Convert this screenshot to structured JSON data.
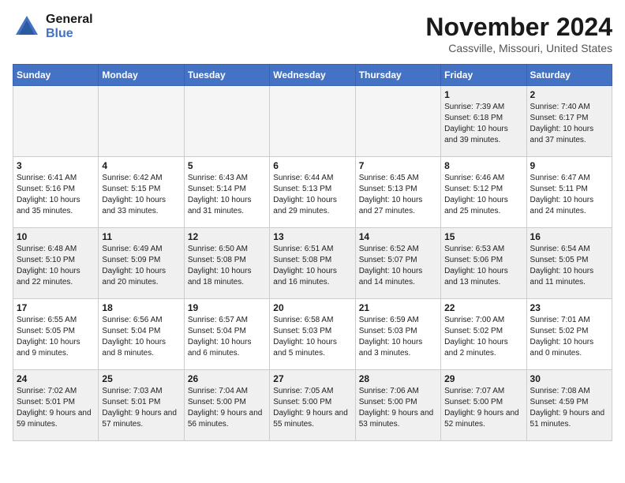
{
  "header": {
    "logo_line1": "General",
    "logo_line2": "Blue",
    "month_title": "November 2024",
    "location": "Cassville, Missouri, United States"
  },
  "weekdays": [
    "Sunday",
    "Monday",
    "Tuesday",
    "Wednesday",
    "Thursday",
    "Friday",
    "Saturday"
  ],
  "weeks": [
    [
      {
        "day": "",
        "empty": true
      },
      {
        "day": "",
        "empty": true
      },
      {
        "day": "",
        "empty": true
      },
      {
        "day": "",
        "empty": true
      },
      {
        "day": "",
        "empty": true
      },
      {
        "day": "1",
        "sunrise": "Sunrise: 7:39 AM",
        "sunset": "Sunset: 6:18 PM",
        "daylight": "Daylight: 10 hours and 39 minutes."
      },
      {
        "day": "2",
        "sunrise": "Sunrise: 7:40 AM",
        "sunset": "Sunset: 6:17 PM",
        "daylight": "Daylight: 10 hours and 37 minutes."
      }
    ],
    [
      {
        "day": "3",
        "sunrise": "Sunrise: 6:41 AM",
        "sunset": "Sunset: 5:16 PM",
        "daylight": "Daylight: 10 hours and 35 minutes."
      },
      {
        "day": "4",
        "sunrise": "Sunrise: 6:42 AM",
        "sunset": "Sunset: 5:15 PM",
        "daylight": "Daylight: 10 hours and 33 minutes."
      },
      {
        "day": "5",
        "sunrise": "Sunrise: 6:43 AM",
        "sunset": "Sunset: 5:14 PM",
        "daylight": "Daylight: 10 hours and 31 minutes."
      },
      {
        "day": "6",
        "sunrise": "Sunrise: 6:44 AM",
        "sunset": "Sunset: 5:13 PM",
        "daylight": "Daylight: 10 hours and 29 minutes."
      },
      {
        "day": "7",
        "sunrise": "Sunrise: 6:45 AM",
        "sunset": "Sunset: 5:13 PM",
        "daylight": "Daylight: 10 hours and 27 minutes."
      },
      {
        "day": "8",
        "sunrise": "Sunrise: 6:46 AM",
        "sunset": "Sunset: 5:12 PM",
        "daylight": "Daylight: 10 hours and 25 minutes."
      },
      {
        "day": "9",
        "sunrise": "Sunrise: 6:47 AM",
        "sunset": "Sunset: 5:11 PM",
        "daylight": "Daylight: 10 hours and 24 minutes."
      }
    ],
    [
      {
        "day": "10",
        "sunrise": "Sunrise: 6:48 AM",
        "sunset": "Sunset: 5:10 PM",
        "daylight": "Daylight: 10 hours and 22 minutes."
      },
      {
        "day": "11",
        "sunrise": "Sunrise: 6:49 AM",
        "sunset": "Sunset: 5:09 PM",
        "daylight": "Daylight: 10 hours and 20 minutes."
      },
      {
        "day": "12",
        "sunrise": "Sunrise: 6:50 AM",
        "sunset": "Sunset: 5:08 PM",
        "daylight": "Daylight: 10 hours and 18 minutes."
      },
      {
        "day": "13",
        "sunrise": "Sunrise: 6:51 AM",
        "sunset": "Sunset: 5:08 PM",
        "daylight": "Daylight: 10 hours and 16 minutes."
      },
      {
        "day": "14",
        "sunrise": "Sunrise: 6:52 AM",
        "sunset": "Sunset: 5:07 PM",
        "daylight": "Daylight: 10 hours and 14 minutes."
      },
      {
        "day": "15",
        "sunrise": "Sunrise: 6:53 AM",
        "sunset": "Sunset: 5:06 PM",
        "daylight": "Daylight: 10 hours and 13 minutes."
      },
      {
        "day": "16",
        "sunrise": "Sunrise: 6:54 AM",
        "sunset": "Sunset: 5:05 PM",
        "daylight": "Daylight: 10 hours and 11 minutes."
      }
    ],
    [
      {
        "day": "17",
        "sunrise": "Sunrise: 6:55 AM",
        "sunset": "Sunset: 5:05 PM",
        "daylight": "Daylight: 10 hours and 9 minutes."
      },
      {
        "day": "18",
        "sunrise": "Sunrise: 6:56 AM",
        "sunset": "Sunset: 5:04 PM",
        "daylight": "Daylight: 10 hours and 8 minutes."
      },
      {
        "day": "19",
        "sunrise": "Sunrise: 6:57 AM",
        "sunset": "Sunset: 5:04 PM",
        "daylight": "Daylight: 10 hours and 6 minutes."
      },
      {
        "day": "20",
        "sunrise": "Sunrise: 6:58 AM",
        "sunset": "Sunset: 5:03 PM",
        "daylight": "Daylight: 10 hours and 5 minutes."
      },
      {
        "day": "21",
        "sunrise": "Sunrise: 6:59 AM",
        "sunset": "Sunset: 5:03 PM",
        "daylight": "Daylight: 10 hours and 3 minutes."
      },
      {
        "day": "22",
        "sunrise": "Sunrise: 7:00 AM",
        "sunset": "Sunset: 5:02 PM",
        "daylight": "Daylight: 10 hours and 2 minutes."
      },
      {
        "day": "23",
        "sunrise": "Sunrise: 7:01 AM",
        "sunset": "Sunset: 5:02 PM",
        "daylight": "Daylight: 10 hours and 0 minutes."
      }
    ],
    [
      {
        "day": "24",
        "sunrise": "Sunrise: 7:02 AM",
        "sunset": "Sunset: 5:01 PM",
        "daylight": "Daylight: 9 hours and 59 minutes."
      },
      {
        "day": "25",
        "sunrise": "Sunrise: 7:03 AM",
        "sunset": "Sunset: 5:01 PM",
        "daylight": "Daylight: 9 hours and 57 minutes."
      },
      {
        "day": "26",
        "sunrise": "Sunrise: 7:04 AM",
        "sunset": "Sunset: 5:00 PM",
        "daylight": "Daylight: 9 hours and 56 minutes."
      },
      {
        "day": "27",
        "sunrise": "Sunrise: 7:05 AM",
        "sunset": "Sunset: 5:00 PM",
        "daylight": "Daylight: 9 hours and 55 minutes."
      },
      {
        "day": "28",
        "sunrise": "Sunrise: 7:06 AM",
        "sunset": "Sunset: 5:00 PM",
        "daylight": "Daylight: 9 hours and 53 minutes."
      },
      {
        "day": "29",
        "sunrise": "Sunrise: 7:07 AM",
        "sunset": "Sunset: 5:00 PM",
        "daylight": "Daylight: 9 hours and 52 minutes."
      },
      {
        "day": "30",
        "sunrise": "Sunrise: 7:08 AM",
        "sunset": "Sunset: 4:59 PM",
        "daylight": "Daylight: 9 hours and 51 minutes."
      }
    ]
  ]
}
